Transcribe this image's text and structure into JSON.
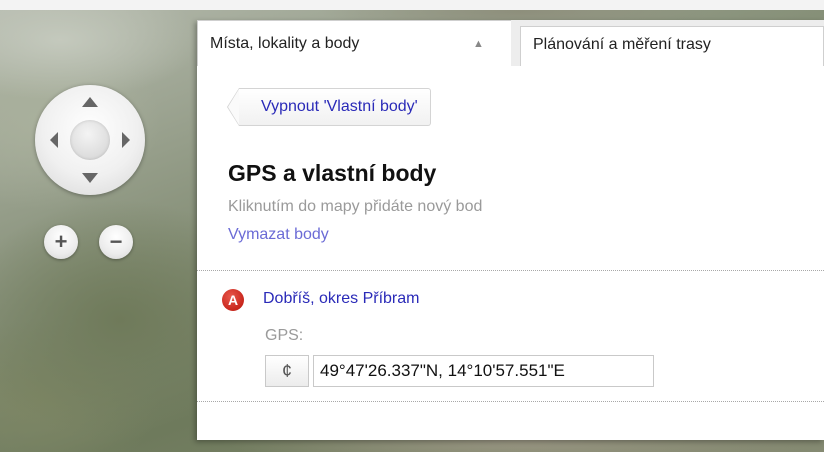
{
  "tabs": {
    "active_label": "Místa, lokality a body",
    "active_caret": "▲",
    "inactive_label": "Plánování a měření trasy"
  },
  "panel": {
    "back_button_label": "Vypnout 'Vlastní body'",
    "section_title": "GPS a vlastní body",
    "section_hint": "Kliknutím do mapy přidáte nový bod",
    "clear_link": "Vymazat body"
  },
  "point": {
    "marker_letter": "A",
    "place_name": "Dobříš, okres Příbram",
    "gps_label": "GPS:",
    "gps_button_glyph": "¢",
    "gps_value": "49°47'26.337\"N, 14°10'57.551\"E"
  },
  "map_controls": {
    "zoom_in": "+",
    "zoom_out": "−"
  },
  "colors": {
    "link": "#2a2ab8",
    "link_muted": "#6b6bd6",
    "marker": "#c8261c"
  }
}
